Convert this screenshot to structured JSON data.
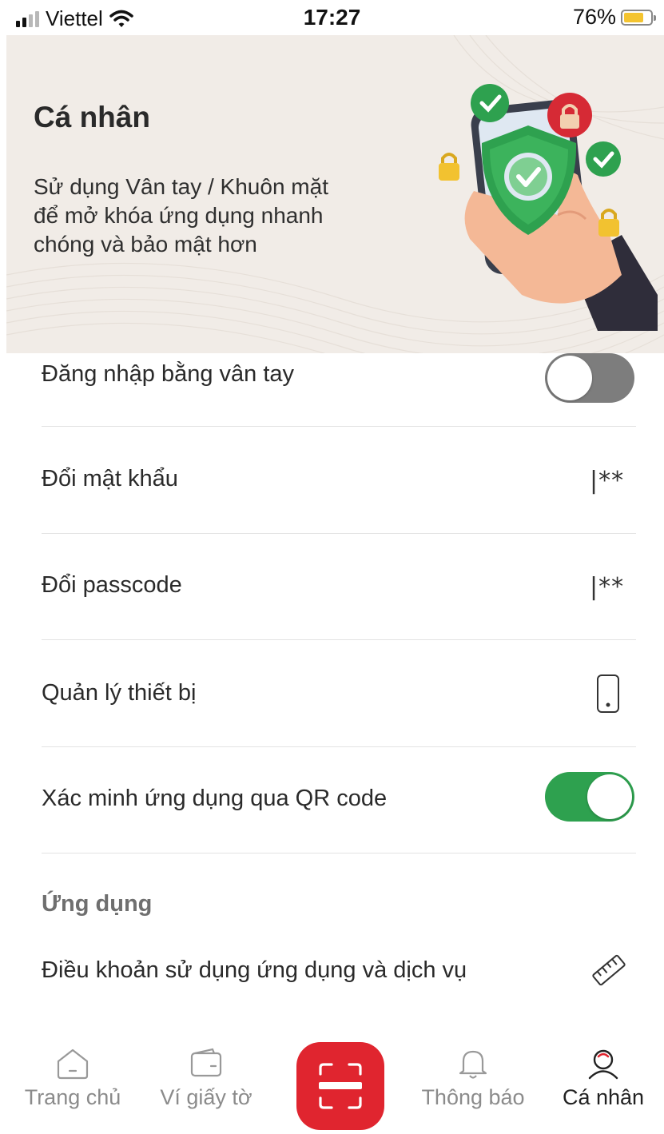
{
  "status_bar": {
    "carrier": "Viettel",
    "time": "17:27",
    "battery": "76%",
    "battery_level": 0.76,
    "battery_color": "#f4c430"
  },
  "banner": {
    "title": "Cá nhân",
    "description": "Sử dụng Vân tay / Khuôn mặt\nđể mở  khóa ứng dụng nhanh\nchóng và bảo mật hơn",
    "background": "#f1ece7"
  },
  "settings": {
    "fingerprint": {
      "label": "Đăng nhập bằng vân tay",
      "enabled": false
    },
    "change_password": {
      "label": "Đổi mật khẩu",
      "icon": "password-icon",
      "icon_text": "|**"
    },
    "change_passcode": {
      "label": "Đổi passcode",
      "icon": "passcode-icon",
      "icon_text": "|**"
    },
    "device_management": {
      "label": "Quản lý thiết bị",
      "icon": "phone-icon"
    },
    "qr_verify": {
      "label": "Xác minh ứng dụng qua QR code",
      "enabled": true,
      "on_color": "#2ea14f"
    }
  },
  "app_section": {
    "title": "Ứng dụng",
    "terms": {
      "label": "Điều khoản sử dụng ứng dụng và dịch vụ",
      "icon": "ruler-icon"
    }
  },
  "tabbar": {
    "tabs": [
      {
        "label": "Trang chủ",
        "icon": "home-icon",
        "active": false
      },
      {
        "label": "Ví giấy tờ",
        "icon": "wallet-icon",
        "active": false
      },
      {
        "label": "",
        "icon": "scan-icon",
        "active": false
      },
      {
        "label": "Thông báo",
        "icon": "bell-icon",
        "active": false
      },
      {
        "label": "Cá nhân",
        "icon": "profile-icon",
        "active": true
      }
    ],
    "scan_color": "#e0252f"
  }
}
